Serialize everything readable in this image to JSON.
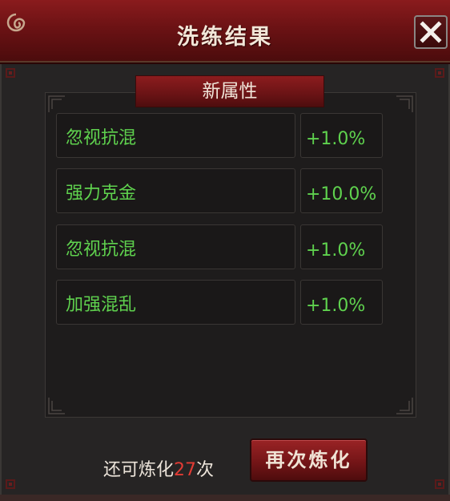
{
  "window": {
    "title": "洗练结果",
    "close_icon": "close-x-icon",
    "accent_color": "#7a1517"
  },
  "section": {
    "header": "新属性"
  },
  "stats": [
    {
      "name": "忽视抗混",
      "value": "+1.0%"
    },
    {
      "name": "强力克金",
      "value": "+10.0%"
    },
    {
      "name": "忽视抗混",
      "value": "+1.0%"
    },
    {
      "name": "加强混乱",
      "value": "+1.0%"
    }
  ],
  "stat_color": "#5fd24e",
  "footer": {
    "remaining_prefix": "还可炼化",
    "remaining_count": "27",
    "remaining_suffix": "次",
    "refine_again_label": "再次炼化"
  }
}
